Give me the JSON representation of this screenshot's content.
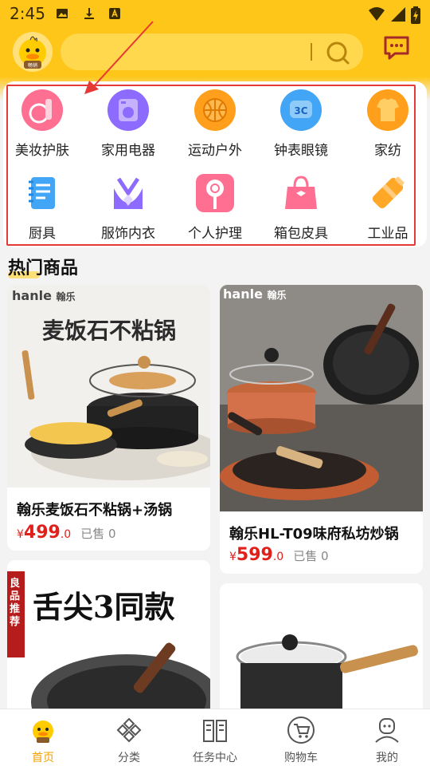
{
  "status_bar": {
    "time": "2:45"
  },
  "header": {
    "logo_text": "畅销"
  },
  "categories": [
    {
      "label": "美妆护肤",
      "icon": "cosmetics-icon"
    },
    {
      "label": "家用电器",
      "icon": "appliance-icon"
    },
    {
      "label": "运动户外",
      "icon": "basketball-icon"
    },
    {
      "label": "钟表眼镜",
      "icon": "watch-3c-icon"
    },
    {
      "label": "家纺",
      "icon": "shirt-icon"
    },
    {
      "label": "厨具",
      "icon": "notebook-icon"
    },
    {
      "label": "服饰内衣",
      "icon": "necklace-icon"
    },
    {
      "label": "个人护理",
      "icon": "lollipop-icon"
    },
    {
      "label": "箱包皮具",
      "icon": "handbag-icon"
    },
    {
      "label": "工业品",
      "icon": "bottle-icon"
    }
  ],
  "hot": {
    "title": "热门商品",
    "products": [
      {
        "title": "翰乐麦饭石不粘锅+汤锅",
        "currency": "¥",
        "price_int": "499",
        "price_dec": ".0",
        "sold": "已售 0",
        "brand_latin": "hanle",
        "brand_cn": "翰乐",
        "banner": "麦饭石不粘锅"
      },
      {
        "title": "翰乐HL-T09味府私坊炒锅",
        "currency": "¥",
        "price_int": "599",
        "price_dec": ".0",
        "sold": "已售 0",
        "brand_latin": "hanle",
        "brand_cn": "翰乐"
      },
      {
        "banner": "舌尖3同款",
        "side_text": "良品推荐"
      },
      {}
    ]
  },
  "bottom_nav": [
    {
      "label": "首页",
      "active": true
    },
    {
      "label": "分类",
      "active": false
    },
    {
      "label": "任务中心",
      "active": false
    },
    {
      "label": "购物车",
      "active": false
    },
    {
      "label": "我的",
      "active": false
    }
  ]
}
